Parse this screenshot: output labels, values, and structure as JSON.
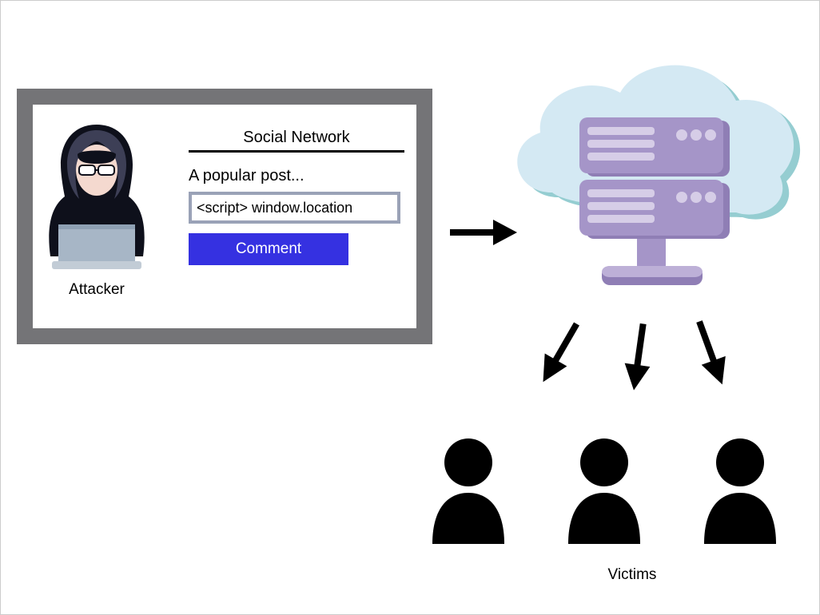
{
  "window": {
    "title": "Social Network",
    "post_label": "A popular post...",
    "comment_field_value": "<script> window.location",
    "comment_button_label": "Comment"
  },
  "labels": {
    "attacker": "Attacker",
    "victims": "Victims"
  },
  "icons": {
    "attacker": "hooded-hacker-icon",
    "server": "cloud-server-icon",
    "arrow_right": "arrow-right-icon",
    "arrow_down": "arrow-down-icon",
    "user": "user-silhouette-icon"
  },
  "colors": {
    "window_border": "#747477",
    "input_border": "#9aa2b7",
    "button_bg": "#3531e1",
    "cloud_fill": "#d4e9f3",
    "cloud_shadow": "#95cdd1",
    "server_fill": "#a595c8",
    "server_light": "#d6cde7"
  }
}
